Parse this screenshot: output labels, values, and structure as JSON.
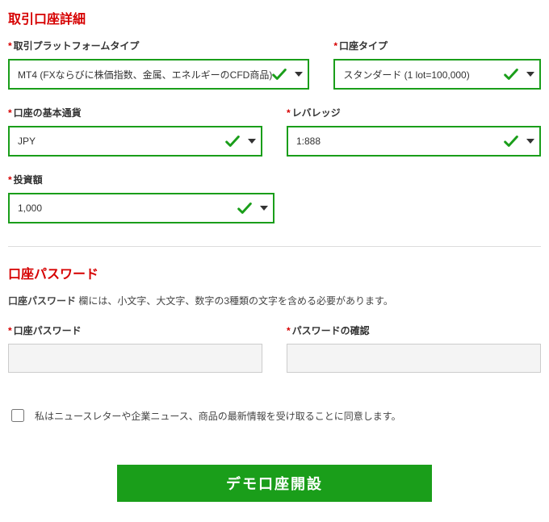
{
  "section1": {
    "title": "取引口座詳細",
    "platform_type": {
      "label": "取引プラットフォームタイプ",
      "value": "MT4 (FXならびに株価指数、金属、エネルギーのCFD商品)"
    },
    "account_type": {
      "label": "口座タイプ",
      "value": "スタンダード (1 lot=100,000)"
    },
    "base_currency": {
      "label": "口座の基本通貨",
      "value": "JPY"
    },
    "leverage": {
      "label": "レバレッジ",
      "value": "1:888"
    },
    "investment": {
      "label": "投資額",
      "value": "1,000"
    }
  },
  "section2": {
    "title": "口座パスワード",
    "helper_strong": "口座パスワード",
    "helper_rest": " 欄には、小文字、大文字、数字の3種類の文字を含める必要があります。",
    "password": {
      "label": "口座パスワード"
    },
    "confirm": {
      "label": "パスワードの確認"
    }
  },
  "consent": {
    "label": "私はニュースレターや企業ニュース、商品の最新情報を受け取ることに同意します。"
  },
  "submit": {
    "label": "デモ口座開設"
  }
}
